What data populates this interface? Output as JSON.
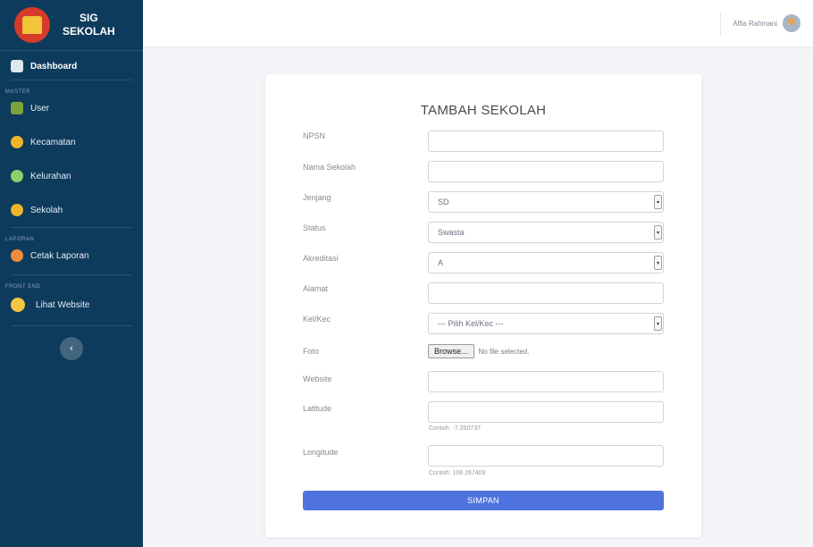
{
  "brand": {
    "line1": "SIG",
    "line2": "SEKOLAH"
  },
  "sidebar": {
    "dashboard": "Dashboard",
    "heading_master": "MASTER",
    "master_items": [
      {
        "label": "User",
        "icon": "user-group-icon"
      },
      {
        "label": "Kecamatan",
        "icon": "kecamatan-icon"
      },
      {
        "label": "Kelurahan",
        "icon": "kelurahan-icon"
      },
      {
        "label": "Sekolah",
        "icon": "school-icon"
      }
    ],
    "heading_laporan": "LAPORAN",
    "laporan_item": "Cetak Laporan",
    "heading_frontend": "FRONT END",
    "frontend_item": "Lihat Website",
    "toggle_glyph": "‹"
  },
  "topbar": {
    "user_name": "Alfia Rahmani"
  },
  "form": {
    "title": "TAMBAH SEKOLAH",
    "npsn_label": "NPSN",
    "npsn_value": "",
    "nama_label": "Nama Sekolah",
    "nama_value": "",
    "jenjang_label": "Jenjang",
    "jenjang_value": "SD",
    "status_label": "Status",
    "status_value": "Swasta",
    "akreditasi_label": "Akreditasi",
    "akreditasi_value": "A",
    "alamat_label": "Alamat",
    "alamat_value": "",
    "kelkec_label": "Kel/Kec",
    "kelkec_value": "--- Pilih Kel/Kec ---",
    "foto_label": "Foto",
    "browse_label": "Browse...",
    "no_file": "No file selected.",
    "website_label": "Website",
    "website_value": "",
    "latitude_label": "Latitude",
    "latitude_value": "",
    "latitude_hint": "Contoh: -7.350737",
    "longitude_label": "Longitude",
    "longitude_value": "",
    "longitude_hint": "Contoh: 108.267409",
    "submit": "SIMPAN"
  },
  "colors": {
    "sidebar_bg": "#0d3b5c",
    "accent": "#4e73df",
    "page_bg": "#f4f5f9"
  }
}
